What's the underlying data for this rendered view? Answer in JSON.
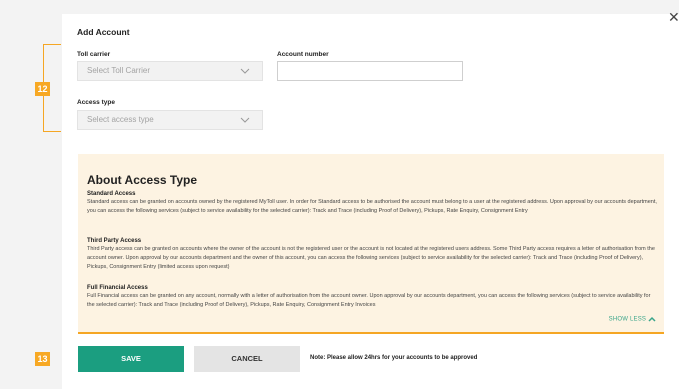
{
  "form": {
    "title": "Add Account",
    "toll_carrier": {
      "label": "Toll carrier",
      "placeholder": "Select Toll Carrier"
    },
    "account_number": {
      "label": "Account number",
      "value": ""
    },
    "access_type": {
      "label": "Access type",
      "placeholder": "Select access type"
    }
  },
  "annotations": {
    "badge_fields": "12",
    "badge_buttons": "13"
  },
  "about": {
    "title": "About Access Type",
    "sections": [
      {
        "title": "Standard Access",
        "text": "Standard access can be granted on accounts owned by the registered MyToll user. In order for Standard access to be authorised the account must belong to a user at the registered address. Upon approval by our accounts department, you can access the following services (subject to service availability for the selected carrier): Track and Trace (including Proof of Delivery), Pickups, Rate Enquiry, Consignment Entry"
      },
      {
        "title": "Third Party Access",
        "text": "Third Party access can be granted on accounts where the owner of the account is not the registered user or the account is not located at the registered users address. Some Third Party access requires a letter of authorisation from the account owner. Upon approval by our accounts department and the owner of this account, you can access the following services (subject to service availability for the selected carrier): Track and Trace (including Proof of Delivery), Pickups, Consignment Entry (limited access upon request)"
      },
      {
        "title": "Full Financial Access",
        "text": "Full Financial access can be granted on any account, normally with a letter of authorisation from the account owner. Upon approval by our accounts department, you can access the following services (subject to service availability for the selected carrier): Track and Trace (including Proof of Delivery), Pickups, Rate Enquiry, Consignment Entry Invoices"
      }
    ],
    "show_less": "SHOW LESS"
  },
  "actions": {
    "save": "SAVE",
    "cancel": "CANCEL",
    "note": "Note: Please allow 24hrs for your accounts to be approved"
  },
  "colors": {
    "accent_orange": "#f5a623",
    "primary_green": "#1b9e80",
    "info_bg": "#fdf3e2"
  },
  "icons": {
    "close": "close-icon",
    "dropdown": "chevron-down-icon",
    "collapse": "chevron-up-icon"
  }
}
